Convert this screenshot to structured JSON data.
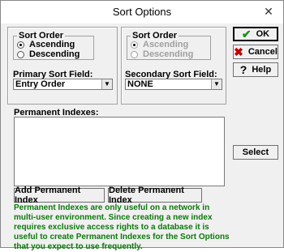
{
  "window": {
    "title": "Sort Options",
    "close_glyph": "✕"
  },
  "sort_order": {
    "title": "Sort Order",
    "ascending": "Ascending",
    "descending": "Descending",
    "selected": "Ascending"
  },
  "primary": {
    "label": "Primary Sort Field:",
    "value": "Entry Order"
  },
  "secondary_sort_order": {
    "title": "Sort Order",
    "ascending": "Ascending",
    "descending": "Descending"
  },
  "secondary": {
    "label": "Secondary Sort Field:",
    "value": "NONE"
  },
  "permanent": {
    "label": "Permanent Indexes:"
  },
  "buttons": {
    "ok": "OK",
    "cancel": "Cancel",
    "help": "Help",
    "select": "Select",
    "add_index": "Add Permanent Index",
    "delete_index": "Delete Permanent Index"
  },
  "icons": {
    "ok": "check-icon",
    "cancel": "x-icon",
    "help": "question-icon",
    "dropdown": "chevron-down-icon"
  },
  "colors": {
    "ok_check": "#1a8f1a",
    "cancel_x": "#c00000",
    "note": "#0a7a0a"
  },
  "note": "Permanent Indexes are only useful on a network in multi-user environment. Since creating a new index requires exclusive access rights to a database it is useful to create Permanent Indexes for the Sort Options that you expect to use frequently."
}
